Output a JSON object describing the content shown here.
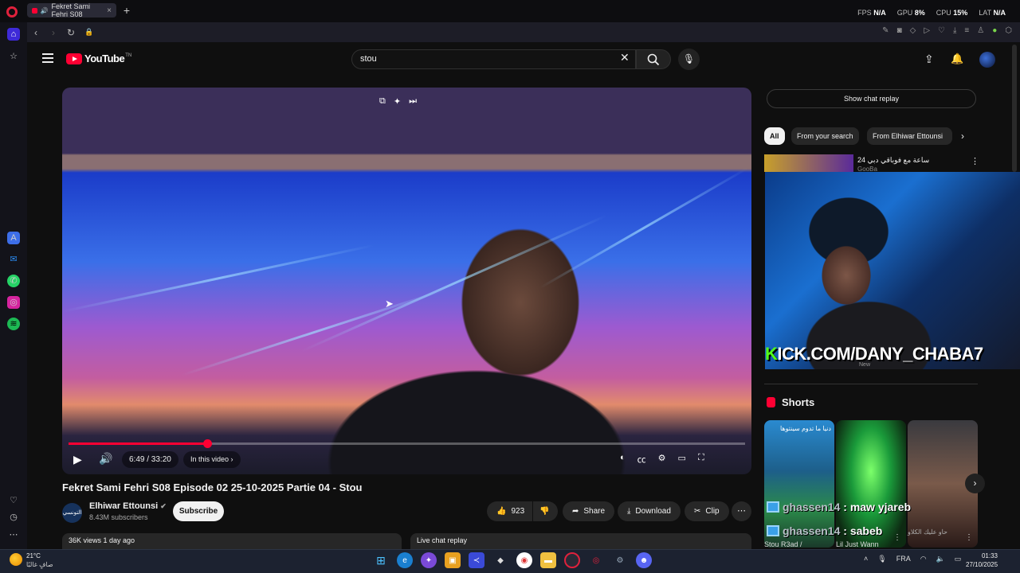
{
  "browser": {
    "tab_title": "Fekret Sami Fehri S08",
    "tab_close": "×",
    "newtab": "+",
    "stats": [
      {
        "label": "FPS",
        "value": "N/A"
      },
      {
        "label": "GPU",
        "value": "8%"
      },
      {
        "label": "CPU",
        "value": "15%"
      },
      {
        "label": "LAT",
        "value": "N/A"
      }
    ]
  },
  "youtube": {
    "logo_text": "YouTube",
    "logo_region": "TN",
    "search_value": "stou"
  },
  "player": {
    "time": "6:49 / 33:20",
    "in_this_video": "In this video ›",
    "progress_fraction": 0.205
  },
  "video": {
    "title": "Fekret Sami Fehri S08 Episode 02 25-10-2025 Partie 04 - Stou",
    "channel_avatar_text": "التونسي",
    "channel_name": "Elhiwar Ettounsi",
    "verified": "✔",
    "subscribers": "8.43M subscribers",
    "subscribe_label": "Subscribe",
    "likes": "923",
    "share_label": "Share",
    "download_label": "Download",
    "clip_label": "Clip",
    "more": "⋯",
    "views": "36K views  1 day ago",
    "live_chat_replay": "Live chat replay"
  },
  "sidebar_right": {
    "show_chat_replay": "Show chat replay",
    "chips": [
      "All",
      "From your search",
      "From Elhiwar Ettounsi"
    ],
    "reco_title": "24 ساعة مع فوباقي دبي",
    "reco_channel": "GooBa",
    "shorts_label": "Shorts"
  },
  "overlay": {
    "kick_k": "K",
    "kick_rest": "ICK.COM/DANY_CHABA7",
    "new_badge": "New",
    "chat": [
      {
        "user": "ghassen14",
        "message": " : maw yjareb"
      },
      {
        "user": "ghassen14",
        "message": " : sabeb"
      }
    ]
  },
  "shorts": {
    "titles": [
      "Stou R3ad /",
      "Lil Just Wann",
      "حاو عليك الكلاو"
    ],
    "overlay_text": "دنيا ما تدوم سينتوها"
  },
  "taskbar": {
    "temp": "21°C",
    "weather_desc": "صافٍ غالبًا",
    "lang": "FRA",
    "time": "01:33",
    "date": "27/10/2025"
  }
}
